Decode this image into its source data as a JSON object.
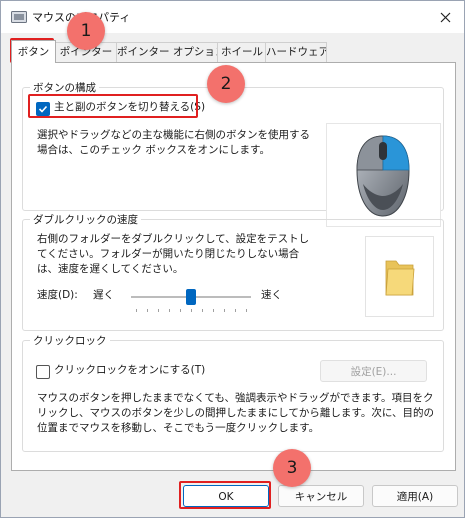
{
  "window": {
    "title": "マウスのプロパティ"
  },
  "tabs": [
    {
      "label": "ボタン"
    },
    {
      "label": "ポインター"
    },
    {
      "label": "ポインター オプション"
    },
    {
      "label": "ホイール"
    },
    {
      "label": "ハードウェア"
    }
  ],
  "button_config": {
    "group_label": "ボタンの構成",
    "swap_checkbox_label": "主と副のボタンを切り替える(S)",
    "swap_checked": true,
    "description": "選択やドラッグなどの主な機能に右側のボタンを使用する場合は、このチェック ボックスをオンにします。"
  },
  "double_click": {
    "group_label": "ダブルクリックの速度",
    "description": "右側のフォルダーをダブルクリックして、設定をテストしてください。フォルダーが開いたり閉じたりしない場合は、速度を遅くしてください。",
    "speed_label": "速度(D):",
    "slow_label": "遅く",
    "fast_label": "速く",
    "slider_value": 0.5
  },
  "click_lock": {
    "group_label": "クリックロック",
    "checkbox_label": "クリックロックをオンにする(T)",
    "checked": false,
    "settings_button": "設定(E)...",
    "description": "マウスのボタンを押したままでなくても、強調表示やドラッグができます。項目をクリックし、マウスのボタンを少しの間押したままにしてから離します。次に、目的の位置までマウスを移動し、そこでもう一度クリックします。"
  },
  "footer": {
    "ok": "OK",
    "cancel": "キャンセル",
    "apply": "適用(A)"
  },
  "annotations": [
    "1",
    "2",
    "3"
  ],
  "colors": {
    "accent": "#0067c0",
    "highlight": "#e02020",
    "badge": "#f3716c"
  }
}
